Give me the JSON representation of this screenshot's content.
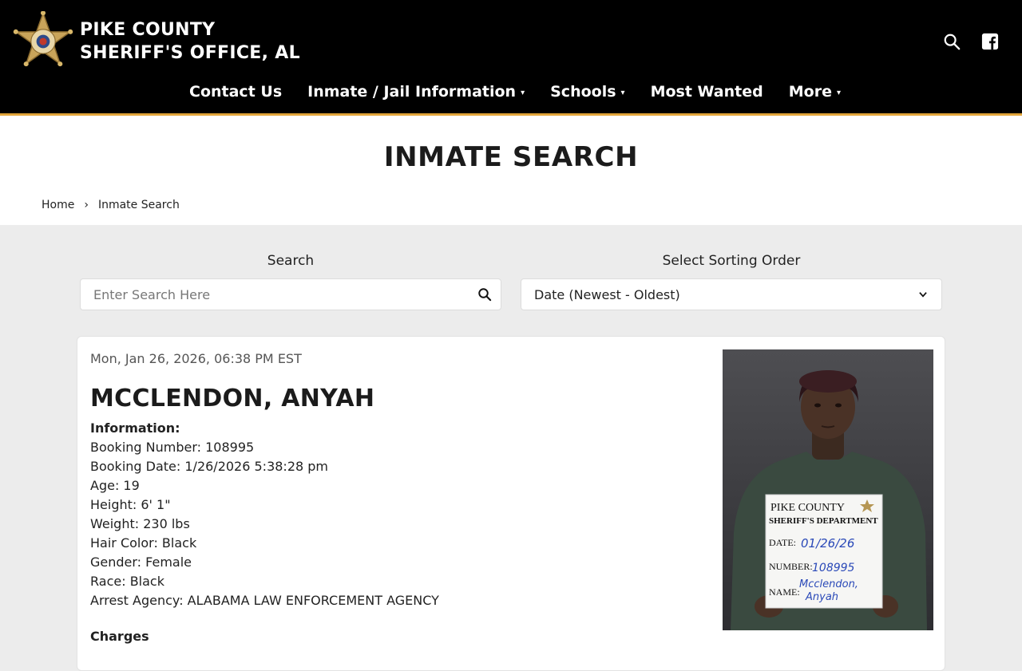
{
  "header": {
    "title_line1": "PIKE COUNTY",
    "title_line2": "SHERIFF'S OFFICE, AL",
    "badge_icon": "sheriff-star-badge",
    "icons": [
      "search-icon",
      "facebook-icon"
    ]
  },
  "nav": {
    "items": [
      {
        "label": "Contact Us",
        "has_dropdown": false
      },
      {
        "label": "Inmate / Jail Information",
        "has_dropdown": true
      },
      {
        "label": "Schools",
        "has_dropdown": true
      },
      {
        "label": "Most Wanted",
        "has_dropdown": false
      },
      {
        "label": "More",
        "has_dropdown": true
      }
    ],
    "caret": "▾"
  },
  "page": {
    "title": "INMATE SEARCH",
    "breadcrumb": {
      "home": "Home",
      "separator": "›",
      "current": "Inmate Search"
    }
  },
  "search": {
    "label": "Search",
    "placeholder": "Enter Search Here",
    "value": ""
  },
  "sort": {
    "label": "Select Sorting Order",
    "selected": "Date (Newest - Oldest)"
  },
  "inmate": {
    "timestamp": "Mon, Jan 26, 2026, 06:38 PM EST",
    "name": "MCCLENDON, ANYAH",
    "info_heading": "Information:",
    "fields": [
      "Booking Number: 108995",
      "Booking Date: 1/26/2026 5:38:28 pm",
      "Age: 19",
      "Height: 6' 1\"",
      "Weight: 230 lbs",
      "Hair Color: Black",
      "Gender: Female",
      "Race: Black",
      "Arrest Agency: ALABAMA LAW ENFORCEMENT AGENCY"
    ],
    "charges_heading": "Charges",
    "mugshot_board": {
      "line1": "PIKE COUNTY",
      "line2": "SHERIFF'S DEPARTMENT",
      "date_label": "DATE:",
      "date_value": "01/26/26",
      "number_label": "NUMBER:",
      "number_value": "108995",
      "name_label": "NAME:",
      "name_value_1": "Mcclendon,",
      "name_value_2": "Anyah"
    }
  },
  "colors": {
    "header_bg": "#000000",
    "accent_gold": "#e2a53a",
    "page_bg": "#ececec",
    "card_bg": "#ffffff"
  }
}
